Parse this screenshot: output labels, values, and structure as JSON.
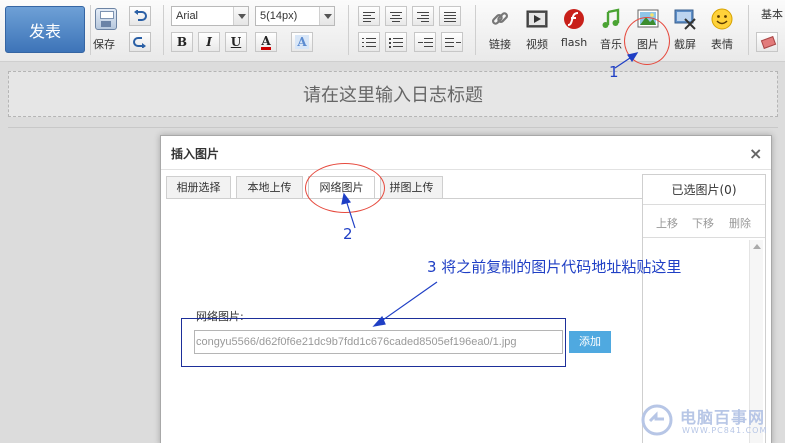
{
  "toolbar": {
    "publish_label": "发表",
    "save_label": "保存",
    "font_family": "Arial",
    "font_size": "5(14px)",
    "tools": [
      {
        "label": "链接",
        "icon": "link-icon"
      },
      {
        "label": "视频",
        "icon": "video-icon"
      },
      {
        "label": "flash",
        "icon": "flash-icon"
      },
      {
        "label": "音乐",
        "icon": "music-icon"
      },
      {
        "label": "图片",
        "icon": "image-icon"
      },
      {
        "label": "截屏",
        "icon": "screenshot-icon"
      },
      {
        "label": "表情",
        "icon": "emoticon-icon"
      }
    ],
    "basic_label": "基本"
  },
  "editor": {
    "title_placeholder": "请在这里输入日志标题"
  },
  "dialog": {
    "title": "插入图片",
    "close_symbol": "×",
    "tabs": [
      {
        "label": "相册选择",
        "active": false
      },
      {
        "label": "本地上传",
        "active": false
      },
      {
        "label": "网络图片",
        "active": true
      },
      {
        "label": "拼图上传",
        "active": false
      }
    ],
    "url_label": "网络图片:",
    "url_value": "congyu5566/d62f0f6e21dc9b7fdd1c676caded8505ef196ea0/1.jpg",
    "add_label": "添加",
    "selected_panel": {
      "title": "已选图片(0)",
      "move_up": "上移",
      "move_down": "下移",
      "delete": "删除"
    }
  },
  "annotations": {
    "step1": "1",
    "step2": "2",
    "step3": "3  将之前复制的图片代码地址粘贴这里",
    "color": "#1f3fc5",
    "ring_color": "#e64a3e"
  },
  "watermark": {
    "text": "电脑百事网",
    "sub": "WWW.PC841.COM"
  }
}
